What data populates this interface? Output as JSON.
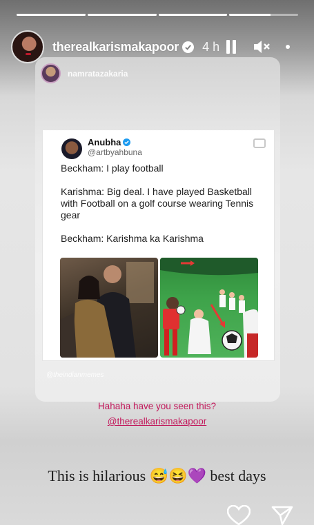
{
  "story": {
    "segments": [
      1,
      1,
      1,
      0.6
    ]
  },
  "header": {
    "username": "therealkarismakapoor",
    "time": "4 h",
    "icons": [
      "verified-badge-icon",
      "pause-icon",
      "mute-icon",
      "more-icon"
    ]
  },
  "reshared_post": {
    "username": "namratazakaria",
    "watermark": "@theindianmemes",
    "tweet": {
      "author_name": "Anubha",
      "author_handle": "@artbyahbuna",
      "lines": [
        "Beckham: I play football",
        "Karishma: Big deal. I have played Basketball with Football on a golf course wearing Tennis gear",
        "Beckham: Karishma ka Karishma"
      ]
    }
  },
  "caption": {
    "line1": "Hahaha have you seen this?",
    "mention": "@therealkarismakapoor"
  },
  "story_text": "This is hilarious 😅😆💜 best days",
  "colors": {
    "caption": "#c2185b",
    "verified": "#1d9bf0"
  },
  "actions": [
    "heart-icon",
    "send-icon"
  ]
}
